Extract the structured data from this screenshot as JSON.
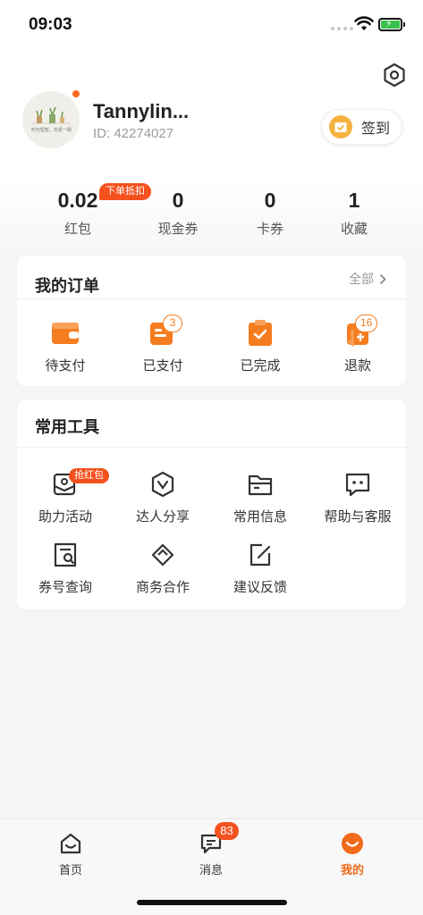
{
  "status_bar": {
    "time": "09:03"
  },
  "profile": {
    "avatar_caption": "时光短暂，珍爱一瞬",
    "username": "Tannylin...",
    "user_id": "ID: 42274027",
    "checkin_label": "签到"
  },
  "stats": [
    {
      "value": "0.02",
      "label": "红包",
      "badge": "下单抵扣"
    },
    {
      "value": "0",
      "label": "现金券"
    },
    {
      "value": "0",
      "label": "卡券"
    },
    {
      "value": "1",
      "label": "收藏"
    }
  ],
  "orders": {
    "title": "我的订单",
    "all_label": "全部",
    "items": [
      {
        "label": "待支付",
        "icon": "wallet-icon"
      },
      {
        "label": "已支付",
        "icon": "receipt-icon",
        "count": "3"
      },
      {
        "label": "已完成",
        "icon": "clipboard-check-icon"
      },
      {
        "label": "退款",
        "icon": "refund-icon",
        "count": "16"
      }
    ]
  },
  "tools": {
    "title": "常用工具",
    "items": [
      {
        "label": "助力活动",
        "icon": "envelope-icon",
        "badge": "抢红包"
      },
      {
        "label": "达人分享",
        "icon": "hexagon-check-icon"
      },
      {
        "label": "常用信息",
        "icon": "folder-icon"
      },
      {
        "label": "帮助与客服",
        "icon": "chat-icon"
      },
      {
        "label": "券号查询",
        "icon": "ticket-search-icon"
      },
      {
        "label": "商务合作",
        "icon": "handshake-icon"
      },
      {
        "label": "建议反馈",
        "icon": "edit-icon"
      }
    ]
  },
  "tabbar": {
    "items": [
      {
        "label": "首页",
        "icon": "home-icon"
      },
      {
        "label": "消息",
        "icon": "message-icon",
        "badge": "83"
      },
      {
        "label": "我的",
        "icon": "profile-smile-icon",
        "active": true
      }
    ]
  },
  "colors": {
    "accent": "#f26a1b",
    "badge": "#f4511e",
    "icon_orange": "#f57c1f",
    "background": "#f5f5f5"
  }
}
